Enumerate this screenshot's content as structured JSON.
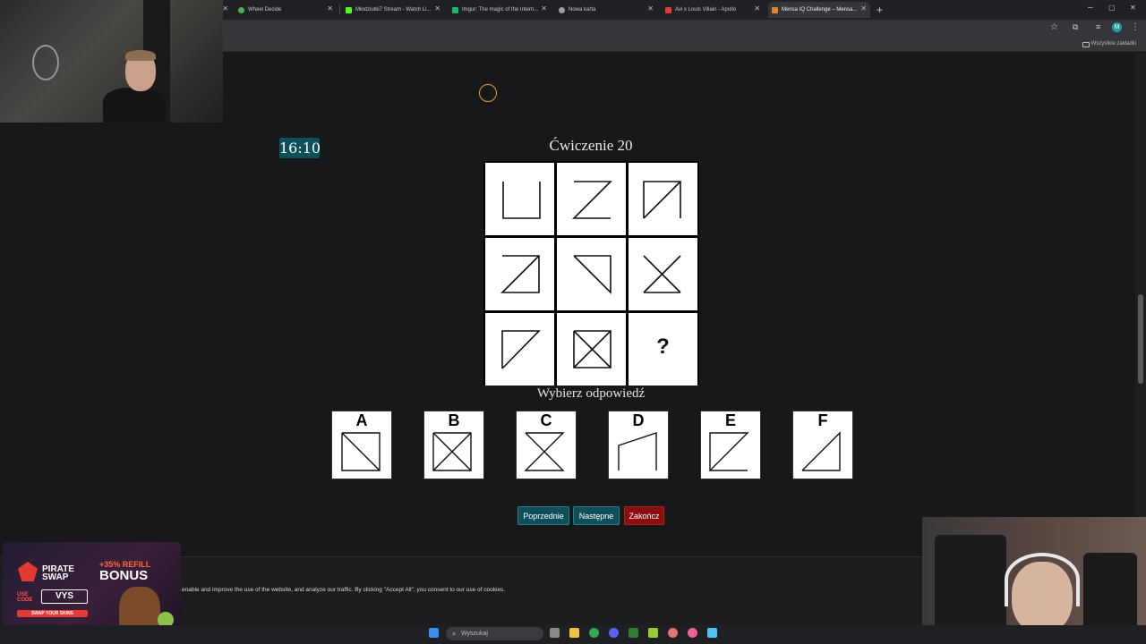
{
  "browser": {
    "tabs": [
      {
        "title": "",
        "active": false
      },
      {
        "title": "Wheel Decide",
        "active": false
      },
      {
        "title": "Młodziutki7 Stream - Watch Li...",
        "active": false
      },
      {
        "title": "Imgur: The magic of the Intern...",
        "active": false
      },
      {
        "title": "Nowa karta",
        "active": false
      },
      {
        "title": "Avi x Louis Villain - Apollo",
        "active": false
      },
      {
        "title": "Mensa IQ Challenge – Mensa...",
        "active": true
      }
    ],
    "new_tab": "+",
    "win_min": "–",
    "win_max": "▢",
    "win_close": "✕",
    "profile_initial": "M",
    "bookmarks_all": "Wszystkie zakładki"
  },
  "quiz": {
    "timer": "16:10",
    "title": "Ćwiczenie 20",
    "question_mark": "?",
    "prompt": "Wybierz odpowiedź",
    "options": [
      {
        "label": "A"
      },
      {
        "label": "B"
      },
      {
        "label": "C"
      },
      {
        "label": "D"
      },
      {
        "label": "E"
      },
      {
        "label": "F"
      }
    ],
    "buttons": {
      "prev": "Poprzednie",
      "next": "Następne",
      "end": "Zakończ"
    }
  },
  "cookie_banner": {
    "text": "enable and improve the use of the website, and analyze our traffic. By clicking \"Accept All\", you consent to our use of cookies."
  },
  "promo": {
    "brand_line1": "PIRATE",
    "brand_line2": "SWAP",
    "refill": "+35% REFILL",
    "bonus": "BONUS",
    "use_line1": "USE",
    "use_line2": "CODE",
    "code": "VYS",
    "tagline": "SWAP YOUR SKINS"
  },
  "taskbar": {
    "search_placeholder": "Wyszukaj"
  },
  "colors": {
    "teal": "#0e4f5a",
    "red": "#8b0d0d",
    "accent_ring": "#e7a33b"
  }
}
